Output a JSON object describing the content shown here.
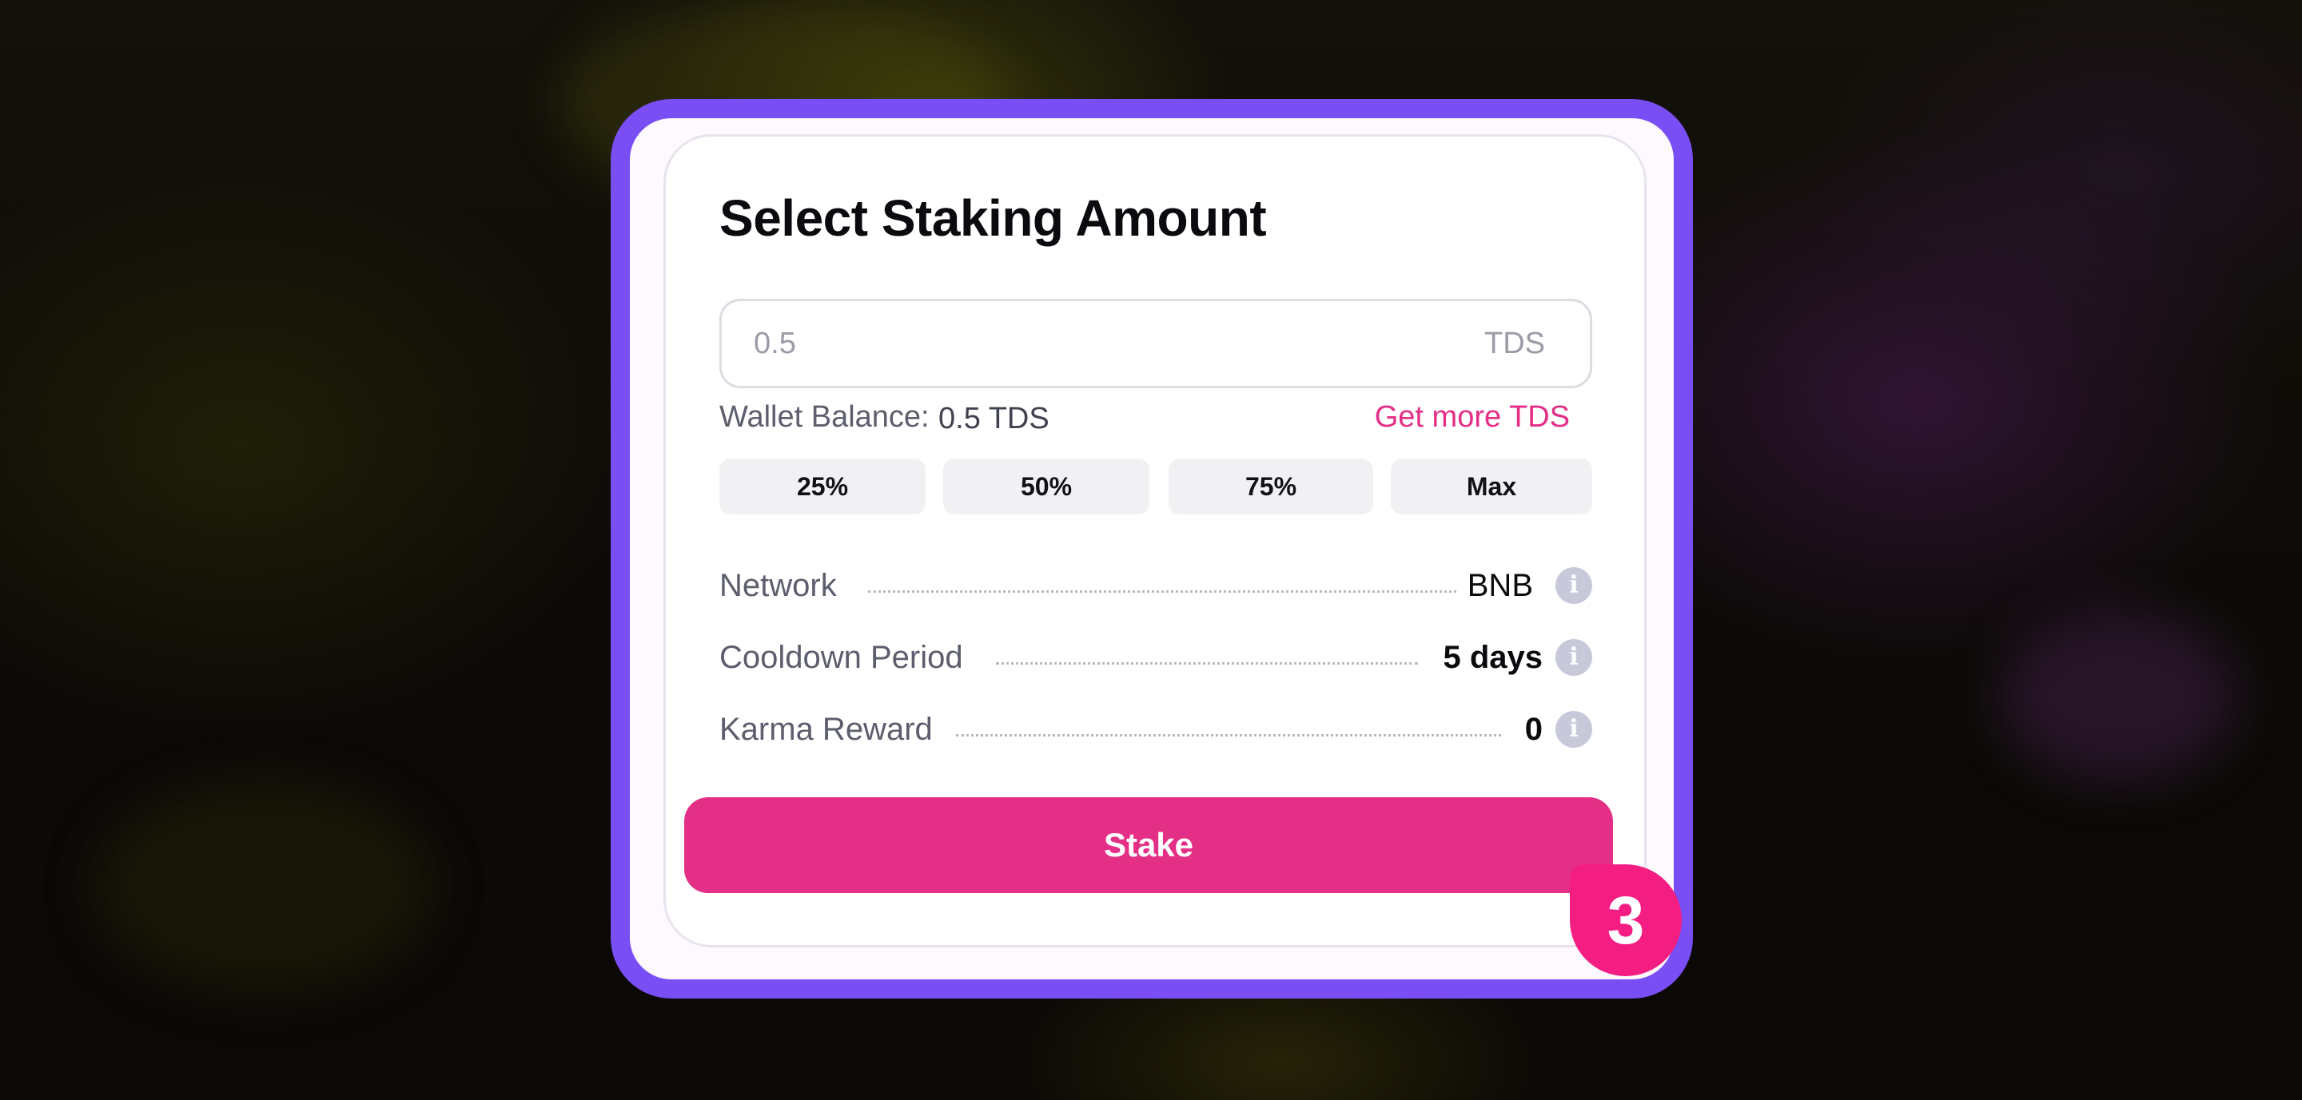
{
  "panel": {
    "title": "Select Staking Amount"
  },
  "amount_input": {
    "placeholder": "0.5",
    "unit": "TDS"
  },
  "wallet": {
    "balance_label": "Wallet Balance:",
    "balance_value": "0.5 TDS",
    "get_more_label": "Get more TDS"
  },
  "percent_buttons": [
    {
      "label": "25%"
    },
    {
      "label": "50%"
    },
    {
      "label": "75%"
    },
    {
      "label": "Max"
    }
  ],
  "details": {
    "network": {
      "label": "Network",
      "value": "BNB"
    },
    "cooldown": {
      "label": "Cooldown Period",
      "value": "5 days"
    },
    "karma": {
      "label": "Karma Reward",
      "value": "0"
    }
  },
  "stake_button": {
    "label": "Stake"
  },
  "step_badge": {
    "number": "3"
  },
  "icons": {
    "info": "info-icon",
    "info_glyph": "i"
  },
  "colors": {
    "frame_border": "#7a4ef5",
    "accent": "#e42f87",
    "badge": "#f41e83",
    "info_icon": "#c7c8da"
  }
}
